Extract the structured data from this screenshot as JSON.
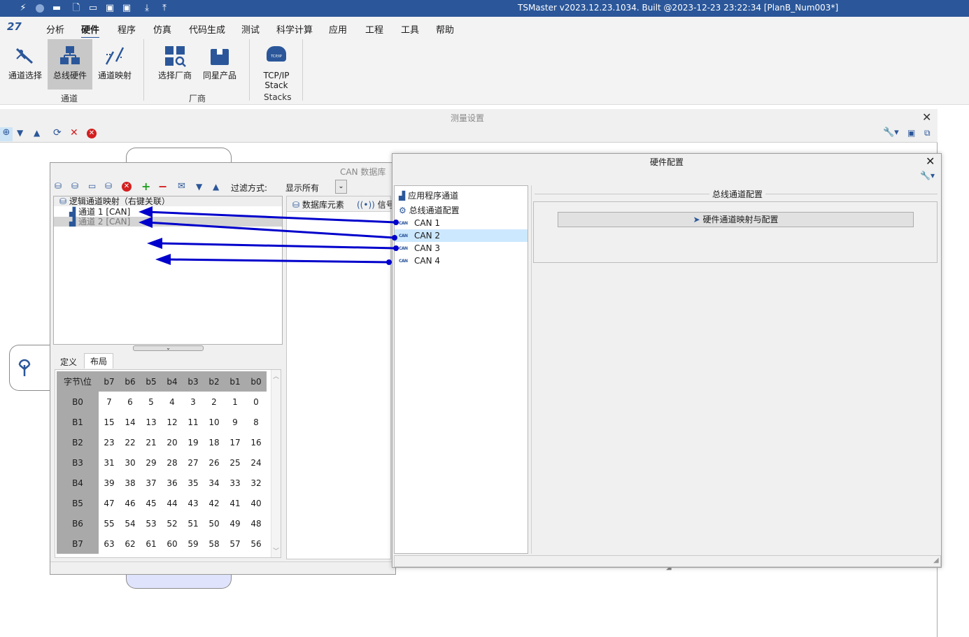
{
  "app": {
    "title": "TSMaster v2023.12.23.1034. Built @2023-12-23 23:22:34 [PlanB_Num003*]"
  },
  "menu": {
    "items": [
      "分析",
      "硬件",
      "程序",
      "仿真",
      "代码生成",
      "测试",
      "科学计算",
      "应用",
      "工程",
      "工具",
      "帮助"
    ],
    "active": "硬件"
  },
  "ribbon": {
    "channel_select": "通道选择",
    "bus_hardware": "总线硬件",
    "channel_mapping": "通道映射",
    "group_channel": "通道",
    "select_vendor": "选择厂商",
    "tosun_products": "同星产品",
    "group_vendor": "厂商",
    "tcp_label_1": "TCP/IP",
    "tcp_label_2": "Stack",
    "tcp_icon_text": "TCP/IP",
    "group_stacks": "Stacks"
  },
  "meas": {
    "title": "测量设置"
  },
  "candb": {
    "title": "CAN 数据库",
    "filter_label": "过滤方式:",
    "filter_value": "显示所有",
    "tree_root": "逻辑通道映射（右键关联）",
    "tree_ch1": "通道 1 [CAN]",
    "tree_ch2": "通道 2 [CAN]",
    "tab_db_elements": "数据库元素",
    "tab_signals": "信号通",
    "tab_define": "定义",
    "tab_layout": "布局",
    "grid_corner": "字节\\位",
    "grid_cols": [
      "b7",
      "b6",
      "b5",
      "b4",
      "b3",
      "b2",
      "b1",
      "b0"
    ],
    "grid_rows": [
      {
        "label": "B0",
        "cells": [
          "7",
          "6",
          "5",
          "4",
          "3",
          "2",
          "1",
          "0"
        ]
      },
      {
        "label": "B1",
        "cells": [
          "15",
          "14",
          "13",
          "12",
          "11",
          "10",
          "9",
          "8"
        ]
      },
      {
        "label": "B2",
        "cells": [
          "23",
          "22",
          "21",
          "20",
          "19",
          "18",
          "17",
          "16"
        ]
      },
      {
        "label": "B3",
        "cells": [
          "31",
          "30",
          "29",
          "28",
          "27",
          "26",
          "25",
          "24"
        ]
      },
      {
        "label": "B4",
        "cells": [
          "39",
          "38",
          "37",
          "36",
          "35",
          "34",
          "33",
          "32"
        ]
      },
      {
        "label": "B5",
        "cells": [
          "47",
          "46",
          "45",
          "44",
          "43",
          "42",
          "41",
          "40"
        ]
      },
      {
        "label": "B6",
        "cells": [
          "55",
          "54",
          "53",
          "52",
          "51",
          "50",
          "49",
          "48"
        ]
      },
      {
        "label": "B7",
        "cells": [
          "63",
          "62",
          "61",
          "60",
          "59",
          "58",
          "57",
          "56"
        ]
      }
    ]
  },
  "hw": {
    "title": "硬件配置",
    "tree_app_channels": "应用程序通道",
    "tree_bus_config": "总线通道配置",
    "can_icon_text": "CAN",
    "channels": [
      "CAN 1",
      "CAN 2",
      "CAN 3",
      "CAN 4"
    ],
    "selected_channel": "CAN 2",
    "panel_title": "总线通道配置",
    "map_button": "硬件通道映射与配置"
  },
  "colors": {
    "titlebar": "#2b579a",
    "arrow": "#0000cc",
    "selection": "#cce8ff",
    "grid_header": "#a9a9a9"
  }
}
